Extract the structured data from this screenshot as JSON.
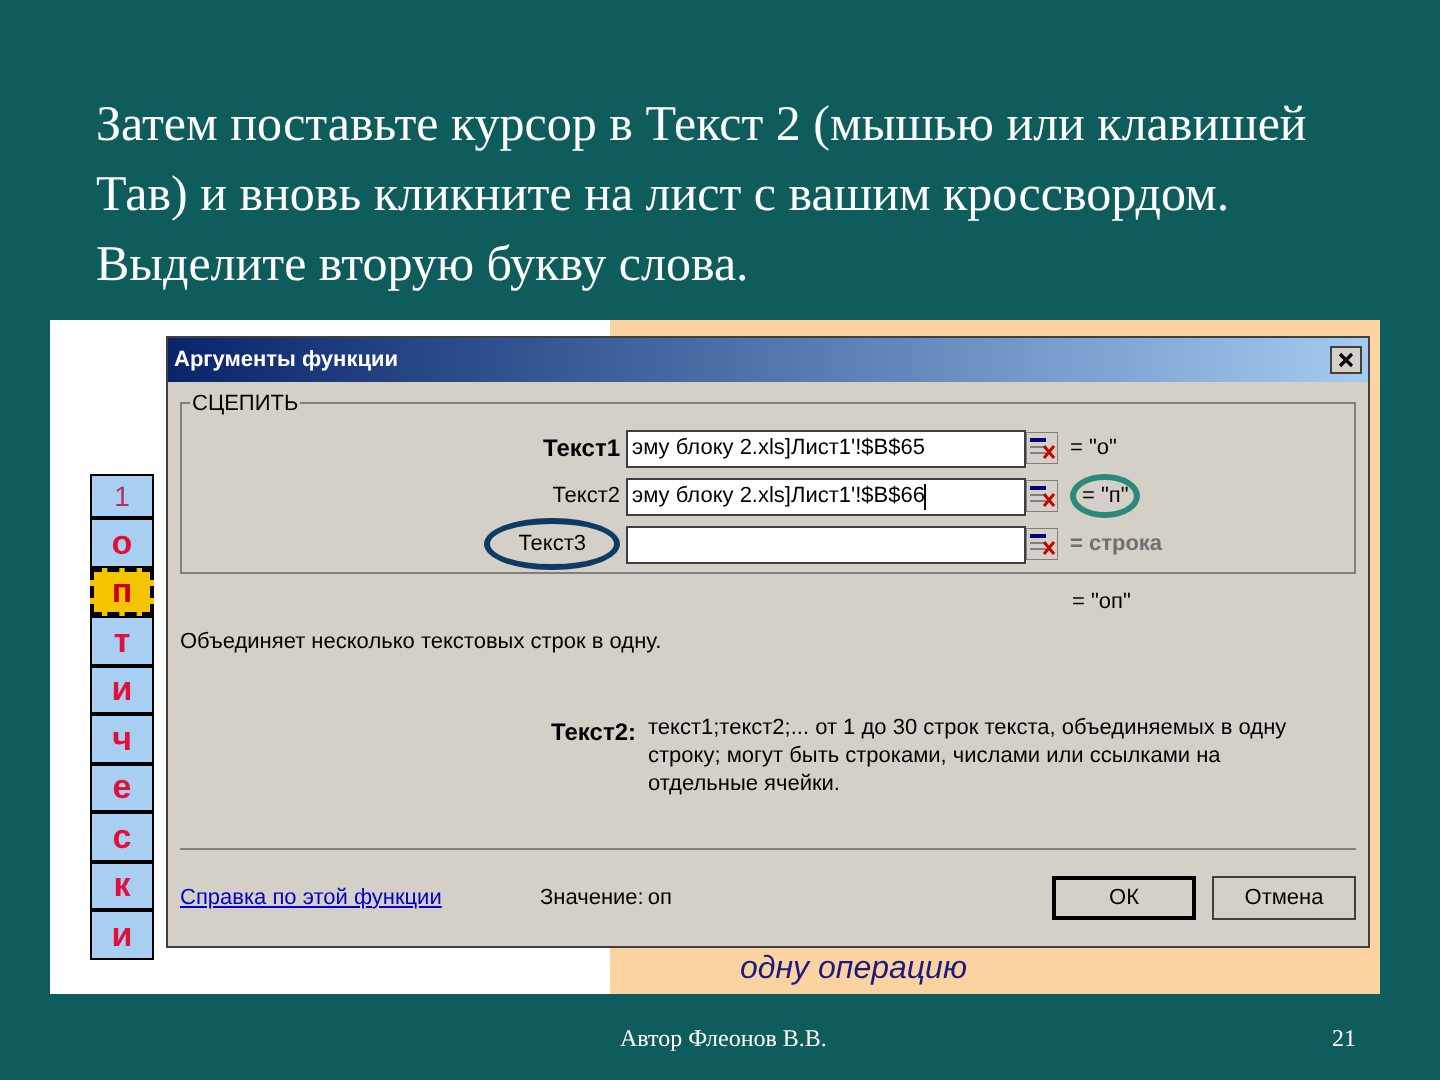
{
  "slide": {
    "title": "Затем поставьте курсор в Текст 2 (мышью или клавишей Тав) и вновь кликните на лист с вашим кроссвордом. Выделите вторую букву слова.",
    "author": "Автор Флеонов В.В.",
    "page_number": "21"
  },
  "sheet": {
    "header": "1",
    "caption": "одну операцию",
    "cells": [
      {
        "letter": "о",
        "selected": false
      },
      {
        "letter": "п",
        "selected": true
      },
      {
        "letter": "т",
        "selected": false
      },
      {
        "letter": "и",
        "selected": false
      },
      {
        "letter": "ч",
        "selected": false
      },
      {
        "letter": "е",
        "selected": false
      },
      {
        "letter": "с",
        "selected": false
      },
      {
        "letter": "к",
        "selected": false
      },
      {
        "letter": "и",
        "selected": false
      }
    ]
  },
  "dialog": {
    "title": "Аргументы функции",
    "function_name": "СЦЕПИТЬ",
    "arguments": [
      {
        "label": "Текст1",
        "required": true,
        "value": "эму блоку 2.xls]Лист1'!$B$65",
        "active": false,
        "label_circled": false,
        "result": "= \"о\"",
        "result_circled": false,
        "result_dim": false
      },
      {
        "label": "Текст2",
        "required": false,
        "value": "эму блоку 2.xls]Лист1'!$B$66",
        "active": true,
        "label_circled": false,
        "result": "= \"п\"",
        "result_circled": true,
        "result_dim": false
      },
      {
        "label": "Текст3",
        "required": false,
        "active": false,
        "label_circled": true,
        "result": "= строка",
        "result_circled": false,
        "result_dim": true
      }
    ],
    "total": "= \"оп\"",
    "description": "Объединяет несколько текстовых строк в одну.",
    "help_label": "Текст2:",
    "help_text": "текст1;текст2;... от 1 до 30 строк текста, объединяемых в одну строку; могут быть строками, числами или ссылками на отдельные ячейки.",
    "help_link": "Справка по этой функции",
    "value_label": "Значение:",
    "value": "оп",
    "buttons": [
      {
        "label": "ОК",
        "default": true
      },
      {
        "label": "Отмена",
        "default": false
      }
    ]
  }
}
